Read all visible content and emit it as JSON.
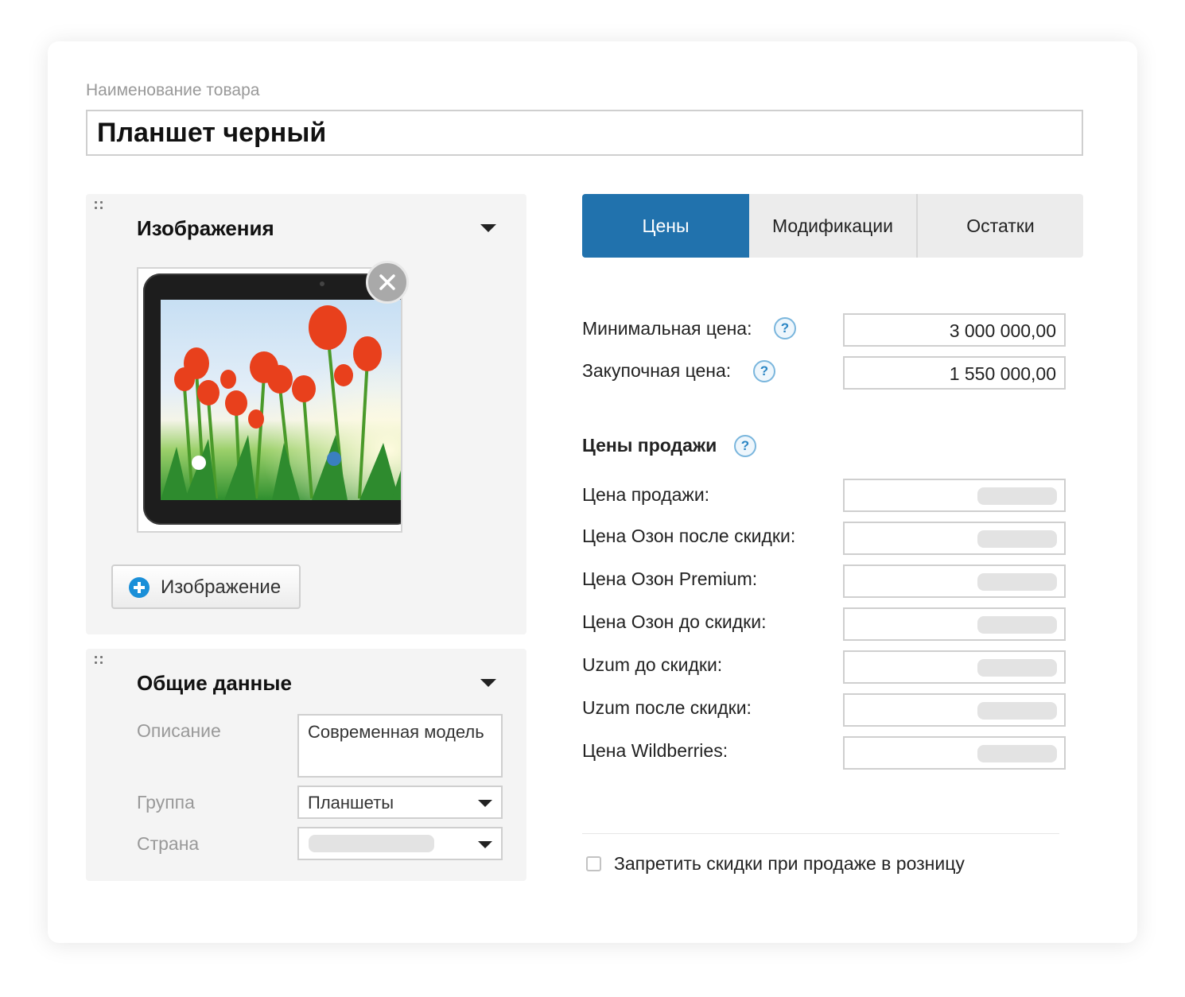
{
  "product": {
    "name_label": "Наименование товара",
    "name_value": "Планшет черный"
  },
  "images_panel": {
    "title": "Изображения",
    "add_button_label": "Изображение"
  },
  "general_panel": {
    "title": "Общие данные",
    "description_label": "Описание",
    "description_value": "Современная модель",
    "group_label": "Группа",
    "group_value": "Планшеты",
    "country_label": "Страна"
  },
  "tabs": [
    {
      "label": "Цены",
      "active": true
    },
    {
      "label": "Модификации",
      "active": false
    },
    {
      "label": "Остатки",
      "active": false
    }
  ],
  "prices": {
    "min_price_label": "Минимальная цена:",
    "min_price_value": "3 000 000,00",
    "purchase_price_label": "Закупочная цена:",
    "purchase_price_value": "1 550 000,00",
    "help_glyph": "?",
    "sale_prices_title": "Цены продажи",
    "sale_prices": [
      {
        "label": "Цена продажи:"
      },
      {
        "label": "Цена Озон после скидки:"
      },
      {
        "label": "Цена Озон Premium:"
      },
      {
        "label": "Цена Озон до скидки:"
      },
      {
        "label": "Uzum до скидки:"
      },
      {
        "label": "Uzum после скидки:"
      },
      {
        "label": "Цена Wildberries:"
      }
    ]
  },
  "forbid_discounts": {
    "label": "Запретить скидки при продаже в розницу",
    "checked": false
  },
  "colors": {
    "accent": "#2172ad",
    "add_icon": "#1a8fd8",
    "help_icon": "#2c86c4"
  },
  "icons": [
    "drag-handle-icon",
    "caret-down-icon",
    "close-icon",
    "plus-icon",
    "help-icon",
    "dropdown-arrow-icon"
  ]
}
